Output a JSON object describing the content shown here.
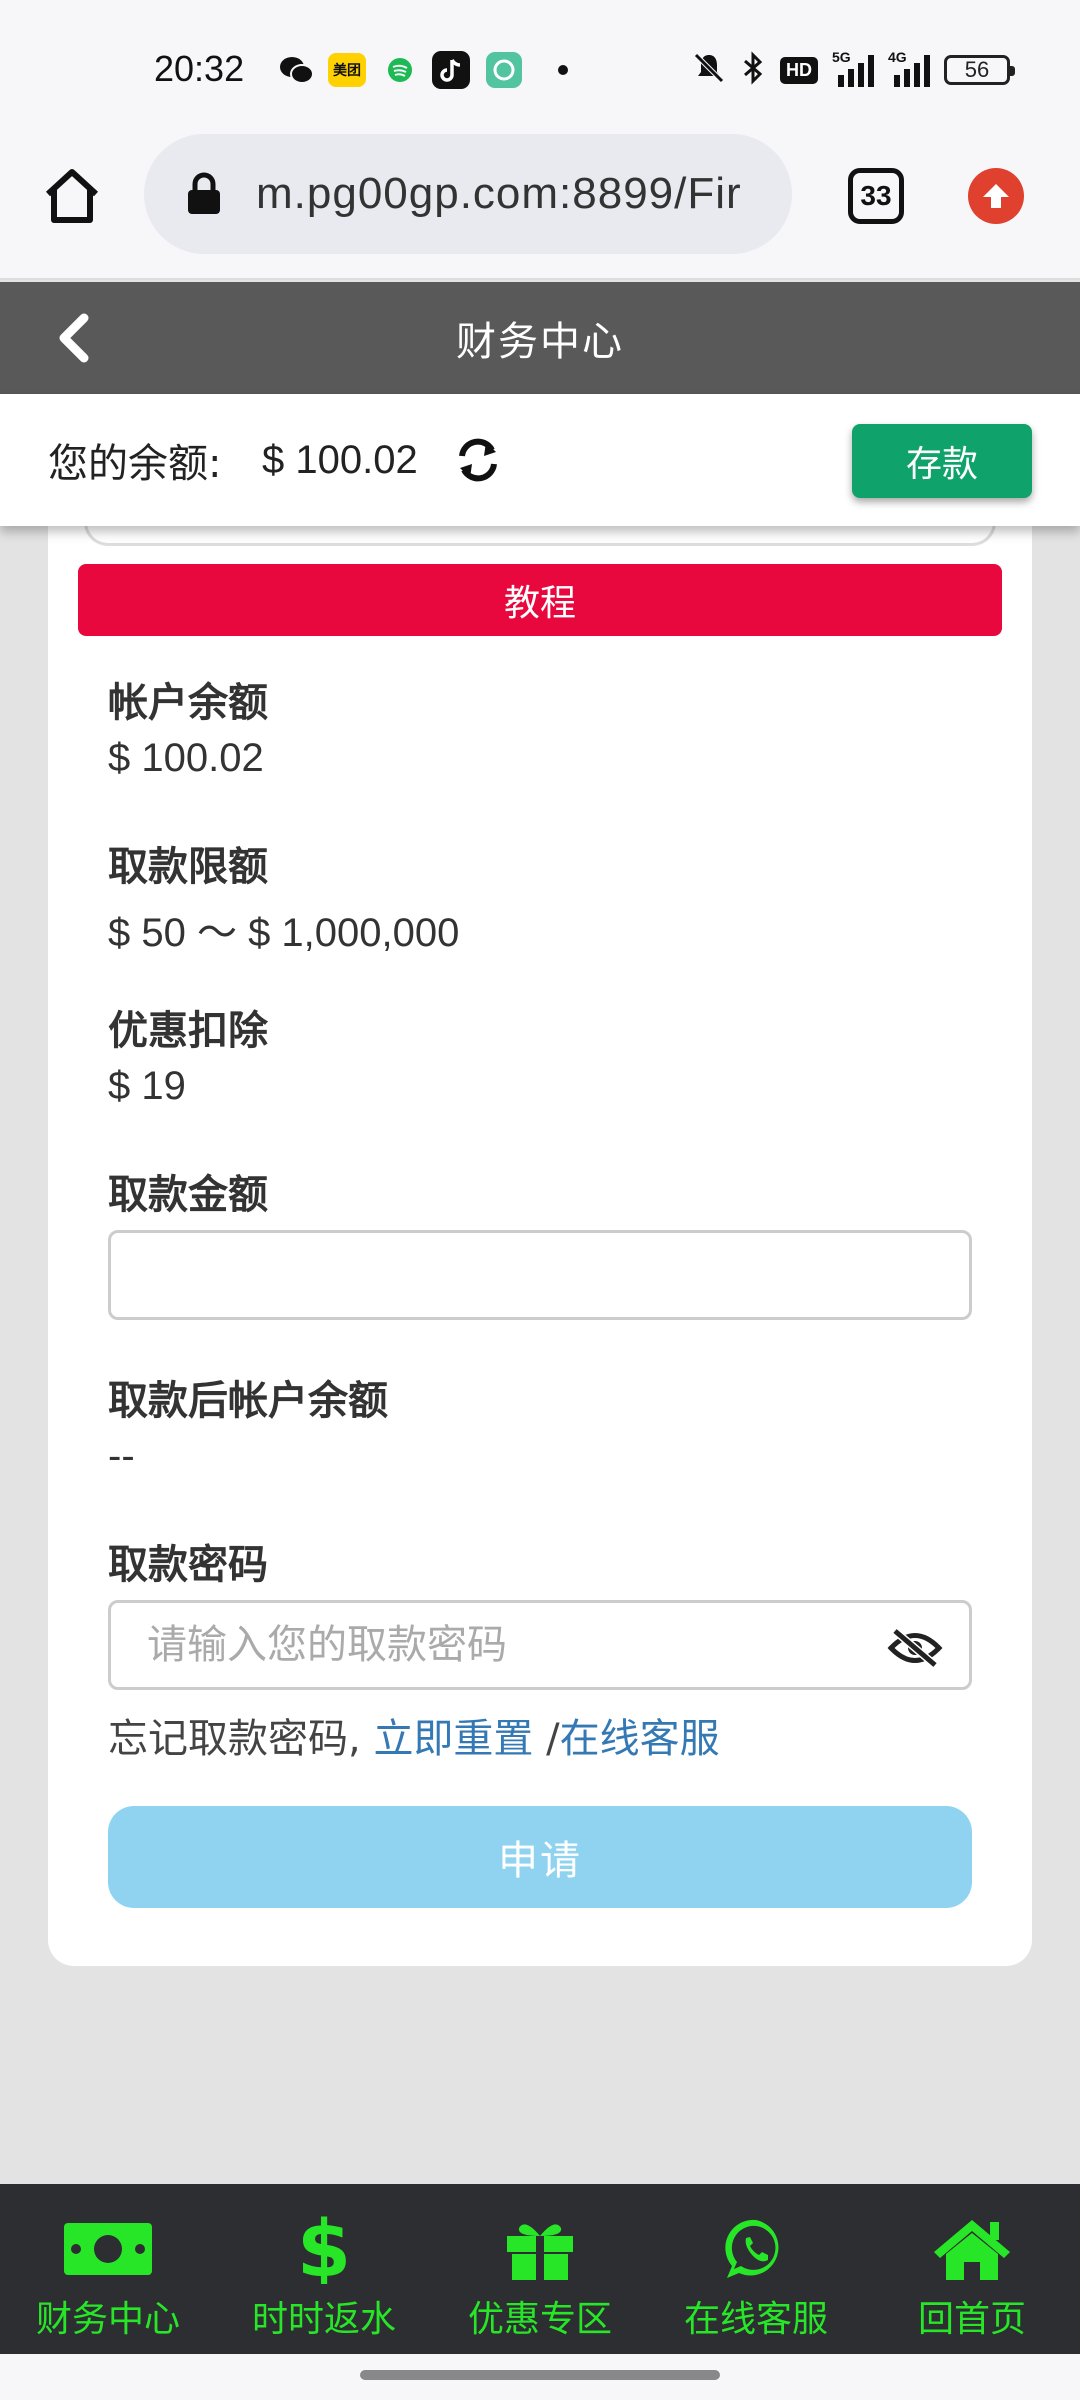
{
  "status_bar": {
    "time": "20:32",
    "notification_icons": [
      "wechat-icon",
      "meituan-icon",
      "spotify-icon",
      "tiktok-icon",
      "vpn-icon",
      "dot-icon"
    ],
    "right_icons": [
      "mute-icon",
      "bluetooth-icon",
      "hd-icon",
      "signal-5g-icon",
      "signal-4g-icon"
    ],
    "meituan_text": "美团",
    "hd_text": "HD",
    "net1": "5G",
    "net2": "4G",
    "battery": "56"
  },
  "browser": {
    "url": "m.pg00gp.com:8899/Fir",
    "tab_count": "33"
  },
  "header": {
    "title": "财务中心"
  },
  "balance_bar": {
    "label": "您的余额:",
    "value": "$ 100.02",
    "deposit_label": "存款"
  },
  "card": {
    "tutorial_label": "教程",
    "account_balance_label": "帐户余额",
    "account_balance_value": "$ 100.02",
    "withdraw_limit_label": "取款限额",
    "withdraw_limit_value": "$ 50 ～ $ 1,000,000",
    "promo_deduction_label": "优惠扣除",
    "promo_deduction_value": "$ 19",
    "withdraw_amount_label": "取款金额",
    "withdraw_amount_value": "",
    "balance_after_label": "取款后帐户余额",
    "balance_after_value": "--",
    "withdraw_password_label": "取款密码",
    "withdraw_password_placeholder": "请输入您的取款密码",
    "forgot_text": "忘记取款密码,",
    "reset_link": "立即重置",
    "separator": " /",
    "support_link": "在线客服",
    "submit_label": "申请"
  },
  "bottom_nav": {
    "items": [
      {
        "label": "财务中心",
        "icon": "money-icon"
      },
      {
        "label": "时时返水",
        "icon": "dollar-icon"
      },
      {
        "label": "优惠专区",
        "icon": "gift-icon"
      },
      {
        "label": "在线客服",
        "icon": "whatsapp-icon"
      },
      {
        "label": "回首页",
        "icon": "home-icon"
      }
    ],
    "color": "#27e627"
  },
  "colors": {
    "header": "#595959",
    "deposit": "#0fa36b",
    "tutorial": "#e8083e",
    "submit": "#8fd3f0",
    "link": "#3478b4"
  }
}
